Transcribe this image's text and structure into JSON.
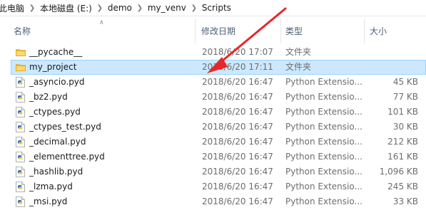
{
  "breadcrumb": [
    "此电脑",
    "本地磁盘 (E:)",
    "demo",
    "my_venv",
    "Scripts"
  ],
  "columns": {
    "name": "名称",
    "date": "修改日期",
    "type": "类型",
    "size": "大小"
  },
  "files": [
    {
      "name": "__pycache__",
      "date": "2018/6/20 17:07",
      "type": "文件夹",
      "size": "",
      "icon": "folder-icon",
      "selected": false
    },
    {
      "name": "my_project",
      "date": "2018/6/20 17:11",
      "type": "文件夹",
      "size": "",
      "icon": "folder-icon",
      "selected": true
    },
    {
      "name": "_asyncio.pyd",
      "date": "2018/6/20 16:47",
      "type": "Python Extensio...",
      "size": "45 KB",
      "icon": "python-file-icon",
      "selected": false
    },
    {
      "name": "_bz2.pyd",
      "date": "2018/6/20 16:47",
      "type": "Python Extensio...",
      "size": "77 KB",
      "icon": "python-file-icon",
      "selected": false
    },
    {
      "name": "_ctypes.pyd",
      "date": "2018/6/20 16:47",
      "type": "Python Extensio...",
      "size": "101 KB",
      "icon": "python-file-icon",
      "selected": false
    },
    {
      "name": "_ctypes_test.pyd",
      "date": "2018/6/20 16:47",
      "type": "Python Extensio...",
      "size": "30 KB",
      "icon": "python-file-icon",
      "selected": false
    },
    {
      "name": "_decimal.pyd",
      "date": "2018/6/20 16:47",
      "type": "Python Extensio...",
      "size": "212 KB",
      "icon": "python-file-icon",
      "selected": false
    },
    {
      "name": "_elementtree.pyd",
      "date": "2018/6/20 16:47",
      "type": "Python Extensio...",
      "size": "161 KB",
      "icon": "python-file-icon",
      "selected": false
    },
    {
      "name": "_hashlib.pyd",
      "date": "2018/6/20 16:47",
      "type": "Python Extensio...",
      "size": "1,096 KB",
      "icon": "python-file-icon",
      "selected": false
    },
    {
      "name": "_lzma.pyd",
      "date": "2018/6/20 16:47",
      "type": "Python Extensio...",
      "size": "245 KB",
      "icon": "python-file-icon",
      "selected": false
    },
    {
      "name": "_msi.pyd",
      "date": "2018/6/20 16:47",
      "type": "Python Extensio...",
      "size": "33 KB",
      "icon": "python-file-icon",
      "selected": false
    }
  ],
  "colors": {
    "selection": "#cce8ff",
    "selection_border": "#99d1ff",
    "header_text": "#4c607a",
    "annotation_arrow": "#e8262a",
    "folder": "#f5c542"
  }
}
